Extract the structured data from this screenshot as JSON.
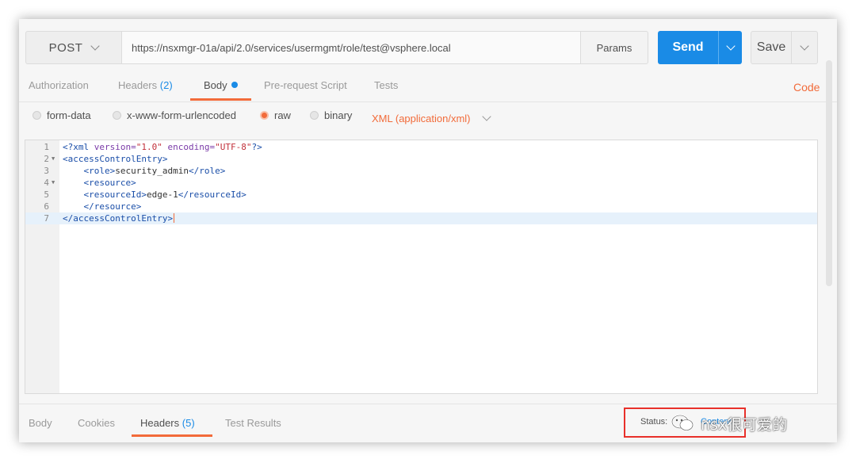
{
  "request": {
    "method": "POST",
    "url": "https://nsxmgr-01a/api/2.0/services/usermgmt/role/test@vsphere.local",
    "params_label": "Params",
    "send_label": "Send",
    "save_label": "Save"
  },
  "request_tabs": {
    "authorization": "Authorization",
    "headers": "Headers",
    "headers_count": "(2)",
    "body": "Body",
    "prerequest": "Pre-request Script",
    "tests": "Tests",
    "code": "Code"
  },
  "body_types": {
    "form_data": "form-data",
    "urlencoded": "x-www-form-urlencoded",
    "raw": "raw",
    "binary": "binary",
    "selected": "raw",
    "content_type": "XML (application/xml)"
  },
  "editor": {
    "line_numbers": [
      "1",
      "2",
      "3",
      "4",
      "5",
      "6",
      "7"
    ],
    "xml_decl_open": "<?xml ",
    "attr_version": "version=",
    "val_version": "\"1.0\"",
    "attr_encoding": "encoding=",
    "val_encoding": "\"UTF-8\"",
    "xml_decl_close": "?>",
    "l2": "<accessControlEntry>",
    "l3_open": "<role>",
    "l3_text": "security_admin",
    "l3_close": "</role>",
    "l4": "<resource>",
    "l5_open": "<resourceId>",
    "l5_text": "edge-1",
    "l5_close": "</resourceId>",
    "l6": "</resource>",
    "l7": "</accessControlEntry>",
    "current_line": 7
  },
  "response_tabs": {
    "body": "Body",
    "cookies": "Cookies",
    "headers": "Headers",
    "headers_count": "(5)",
    "test_results": "Test Results",
    "status_label": "Status:",
    "status_value": "Content"
  },
  "watermark": "nsx很可爱的",
  "colors": {
    "accent": "#f26b3a",
    "primary": "#1a8be6",
    "highlight_box": "#e8302a"
  }
}
